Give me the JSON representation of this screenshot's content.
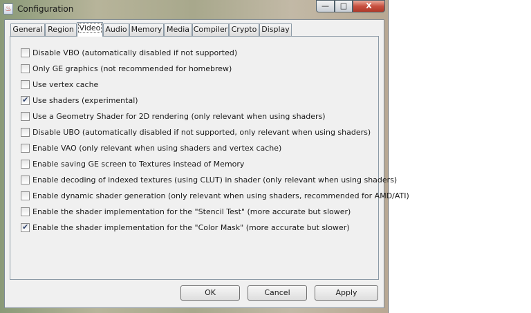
{
  "window": {
    "title": "Configuration",
    "icon": "java-app-icon"
  },
  "window_controls": {
    "minimize": "—",
    "maximize": "□",
    "close": "X"
  },
  "tabs": [
    {
      "label": "General"
    },
    {
      "label": "Region"
    },
    {
      "label": "Video",
      "active": true
    },
    {
      "label": "Audio"
    },
    {
      "label": "Memory"
    },
    {
      "label": "Media"
    },
    {
      "label": "Compiler"
    },
    {
      "label": "Crypto"
    },
    {
      "label": "Display"
    }
  ],
  "options": [
    {
      "label": "Disable VBO (automatically disabled if not supported)",
      "checked": false
    },
    {
      "label": "Only GE graphics (not recommended for homebrew)",
      "checked": false
    },
    {
      "label": "Use vertex cache",
      "checked": false
    },
    {
      "label": "Use shaders (experimental)",
      "checked": true
    },
    {
      "label": "Use a Geometry Shader for 2D rendering (only relevant when using shaders)",
      "checked": false
    },
    {
      "label": "Disable UBO (automatically disabled if not supported, only relevant when using shaders)",
      "checked": false
    },
    {
      "label": "Enable VAO (only relevant when using shaders and vertex cache)",
      "checked": false
    },
    {
      "label": "Enable saving GE screen to Textures instead of Memory",
      "checked": false
    },
    {
      "label": "Enable decoding of indexed textures (using CLUT) in shader (only relevant when using shaders)",
      "checked": false
    },
    {
      "label": "Enable dynamic shader generation (only relevant when using shaders, recommended for AMD/ATI)",
      "checked": false
    },
    {
      "label": "Enable the shader implementation for the \"Stencil Test\" (more accurate but slower)",
      "checked": false
    },
    {
      "label": "Enable the shader implementation for the \"Color Mask\" (more accurate but slower)",
      "checked": true
    }
  ],
  "buttons": {
    "ok": "OK",
    "cancel": "Cancel",
    "apply": "Apply"
  }
}
